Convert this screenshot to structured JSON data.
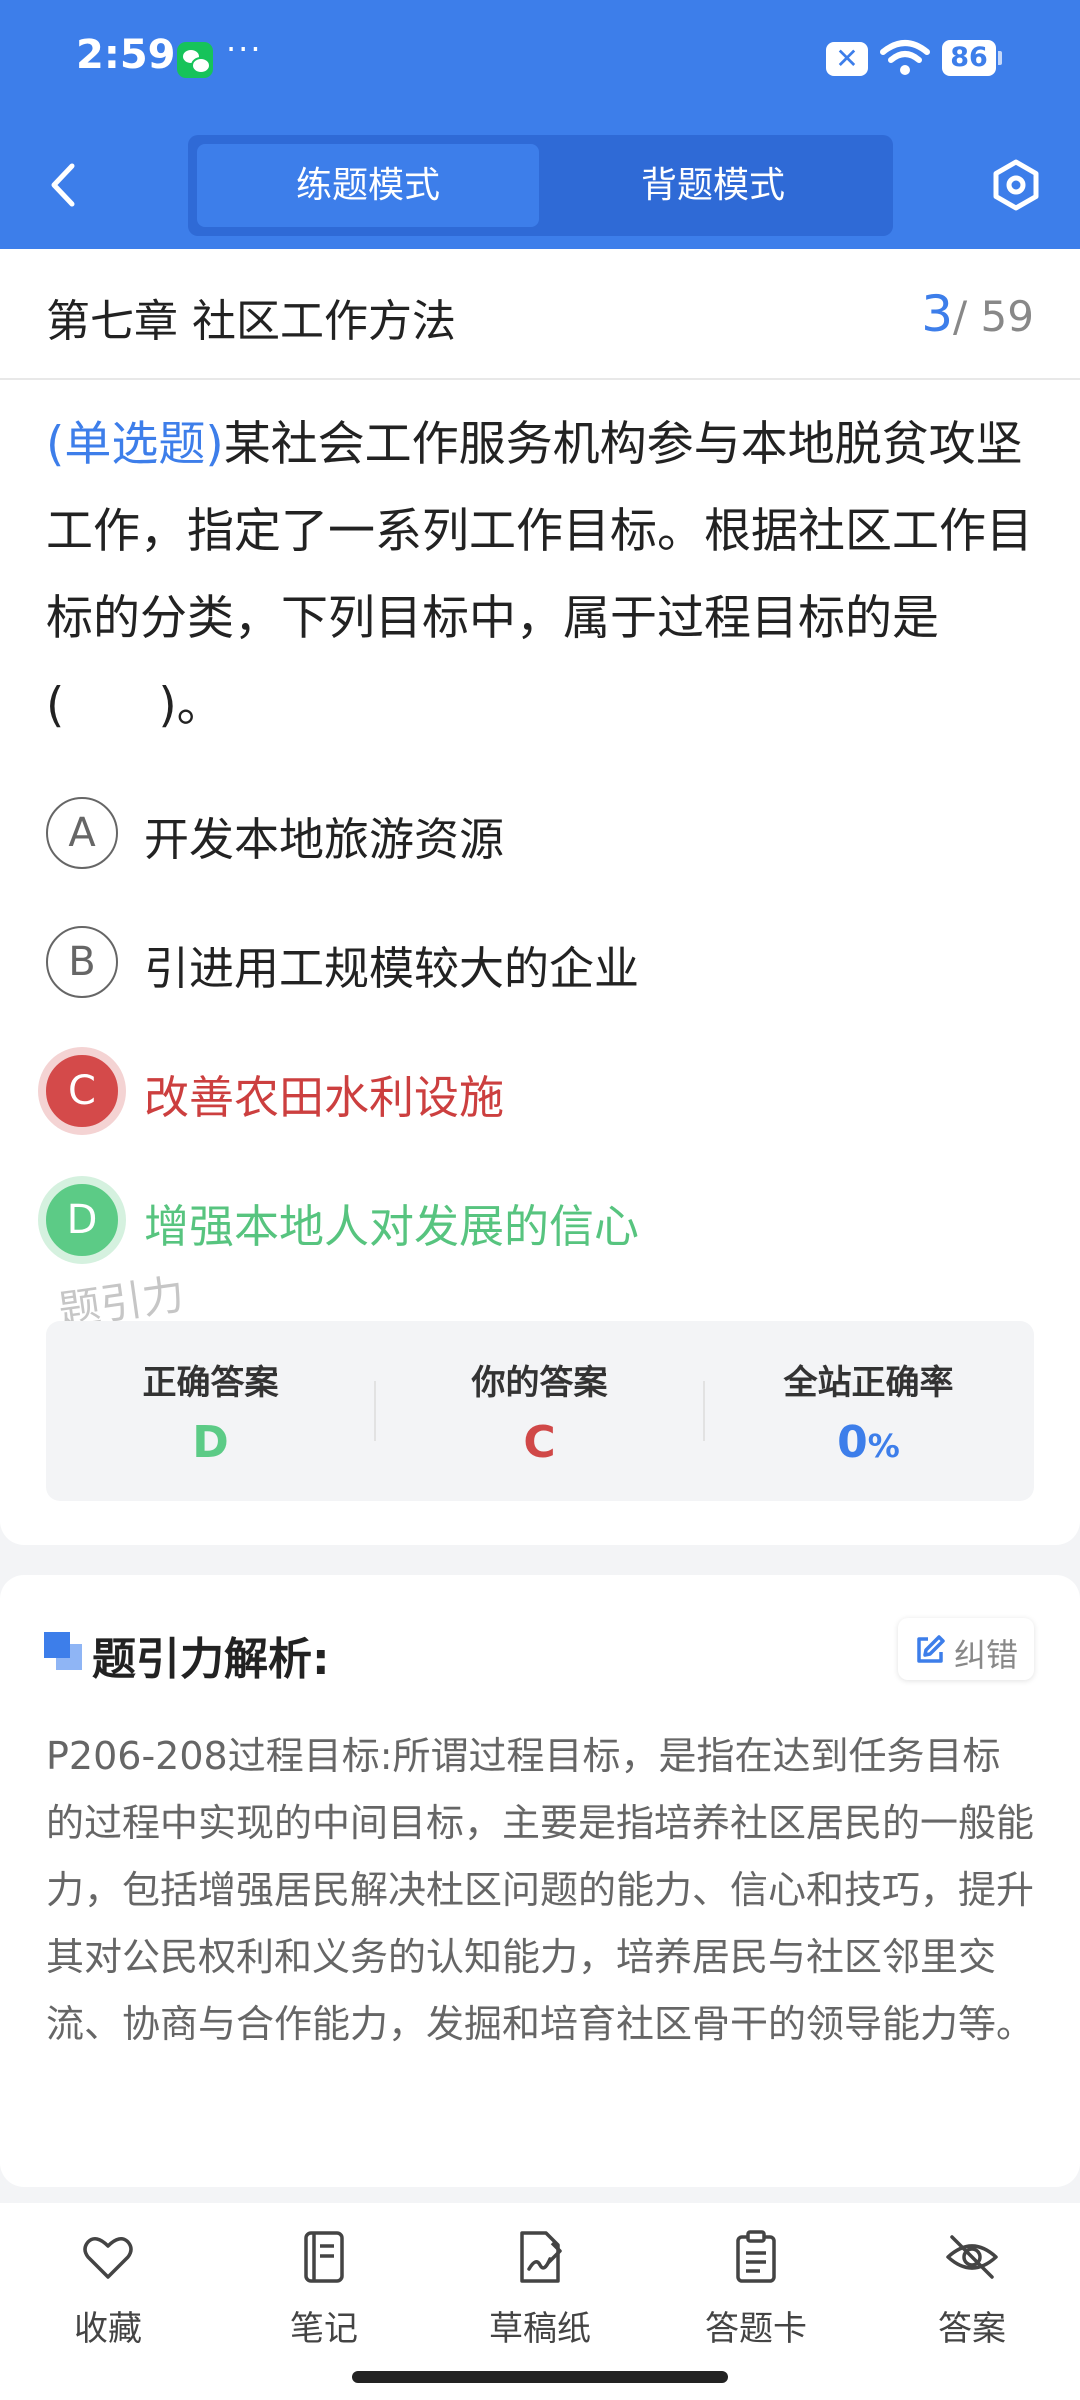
{
  "status_bar": {
    "time": "2:59",
    "dots": "···",
    "battery": "86",
    "x_badge": "✕"
  },
  "header": {
    "tabs": [
      {
        "label": "练题模式",
        "active": true
      },
      {
        "label": "背题模式",
        "active": false
      }
    ]
  },
  "question": {
    "chapter": "第七章 社区工作方法",
    "current": "3",
    "total": "/ 59",
    "type": "(单选题)",
    "text": "某社会工作服务机构参与本地脱贫攻坚工作，指定了一系列工作目标。根据社区工作目标的分类，下列目标中，属于过程目标的是(　　)。",
    "options": [
      {
        "letter": "A",
        "text": "开发本地旅游资源",
        "state": "normal"
      },
      {
        "letter": "B",
        "text": "引进用工规模较大的企业",
        "state": "normal"
      },
      {
        "letter": "C",
        "text": "改善农田水利设施",
        "state": "wrong"
      },
      {
        "letter": "D",
        "text": "增强本地人对发展的信心",
        "state": "right"
      }
    ],
    "watermark": "题引力"
  },
  "answers": {
    "correct_label": "正确答案",
    "correct_value": "D",
    "yours_label": "你的答案",
    "yours_value": "C",
    "rate_label": "全站正确率",
    "rate_value": "0",
    "rate_unit": "%"
  },
  "analysis": {
    "title": "题引力解析:",
    "correct_button": "纠错",
    "text": "P206-208过程目标:所谓过程目标，是指在达到任务目标的过程中实现的中间目标，主要是指培养社区居民的一般能力，包括增强居民解决杜区问题的能力、信心和技巧，提升其对公民权利和义务的认知能力，培养居民与社区邻里交流、协商与合作能力，发掘和培育社区骨干的领导能力等。"
  },
  "bottom_nav": [
    {
      "label": "收藏",
      "icon": "heart-icon"
    },
    {
      "label": "笔记",
      "icon": "notebook-icon"
    },
    {
      "label": "草稿纸",
      "icon": "draft-icon"
    },
    {
      "label": "答题卡",
      "icon": "answer-card-icon"
    },
    {
      "label": "答案",
      "icon": "eye-off-icon"
    }
  ],
  "colors": {
    "primary": "#3d7eea",
    "wrong": "#d44a4a",
    "right": "#5ccb86"
  }
}
